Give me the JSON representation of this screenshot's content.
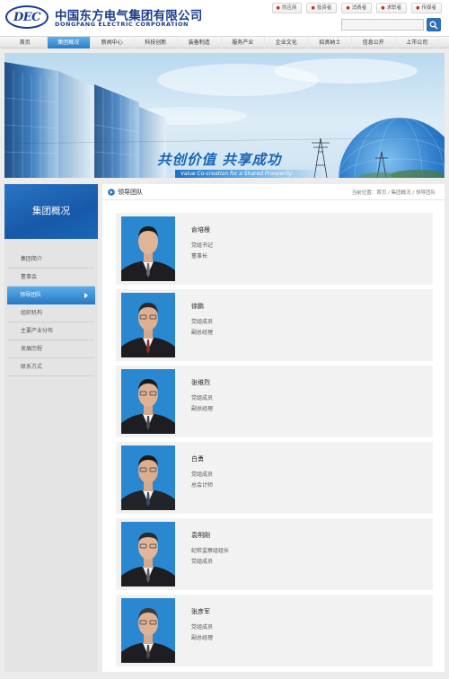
{
  "header": {
    "logo_abbr": "DEC",
    "company_cn": "中国东方电气集团有限公司",
    "company_en": "DONGFANG ELECTRIC CORPORATION",
    "quick_links": [
      "供应商",
      "投资者",
      "消费者",
      "求职者",
      "传媒者"
    ],
    "search_placeholder": ""
  },
  "nav": {
    "items": [
      "首页",
      "集团概况",
      "新闻中心",
      "科技创新",
      "装备制造",
      "服务产业",
      "企业文化",
      "招贤纳士",
      "信息公开",
      "上市公司"
    ],
    "active_index": 1
  },
  "banner": {
    "slogan_cn": "共创价值 共享成功",
    "slogan_en": "Value Co-creation for a Shared Prosperity"
  },
  "sidebar": {
    "title": "集团概况",
    "items": [
      "集团简介",
      "董事会",
      "领导团队",
      "组织机构",
      "主要产业分布",
      "发展历程",
      "联系方式"
    ],
    "active_index": 2
  },
  "content": {
    "title": "领导团队",
    "breadcrumb": "当前位置：首页 / 集团概况 / 领导团队"
  },
  "leaders": [
    {
      "name": "俞培根",
      "roles": [
        "党组书记",
        "董事长"
      ]
    },
    {
      "name": "徐鹏",
      "roles": [
        "党组成员",
        "副总经理"
      ]
    },
    {
      "name": "张维烈",
      "roles": [
        "党组成员",
        "副总经理"
      ]
    },
    {
      "name": "白勇",
      "roles": [
        "党组成员",
        "总会计师"
      ]
    },
    {
      "name": "袁明刚",
      "roles": [
        "纪检监察组组长",
        "党组成员"
      ]
    },
    {
      "name": "张彦军",
      "roles": [
        "党组成员",
        "副总经理"
      ]
    }
  ],
  "colors": {
    "brand": "#1a3d8f",
    "accent": "#2a7cc8",
    "sidebar_head": "#1759a9"
  }
}
